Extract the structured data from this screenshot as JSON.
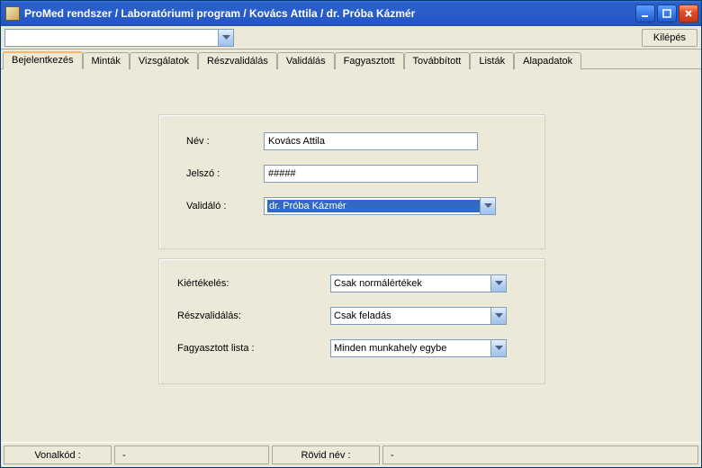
{
  "window": {
    "title": "ProMed rendszer / Laboratóriumi program / Kovács Attila / dr. Próba Kázmér"
  },
  "toolbar": {
    "combo_value": "",
    "exit_label": "Kilépés"
  },
  "tabs": [
    {
      "label": "Bejelentkezés",
      "active": true
    },
    {
      "label": "Minták"
    },
    {
      "label": "Vizsgálatok"
    },
    {
      "label": "Részvalidálás"
    },
    {
      "label": "Validálás"
    },
    {
      "label": "Fagyasztott"
    },
    {
      "label": "Továbbított"
    },
    {
      "label": "Listák"
    },
    {
      "label": "Alapadatok"
    }
  ],
  "login_panel": {
    "name_label": "Név :",
    "name_value": "Kovács Attila",
    "password_label": "Jelszó :",
    "password_value": "#####",
    "validator_label": "Validáló :",
    "validator_value": "dr. Próba Kázmér"
  },
  "options_panel": {
    "evaluation_label": "Kiértékelés:",
    "evaluation_value": "Csak normálértékek",
    "partvalidation_label": "Részvalidálás:",
    "partvalidation_value": "Csak feladás",
    "frozenlist_label": "Fagyasztott lista :",
    "frozenlist_value": "Minden munkahely egybe"
  },
  "statusbar": {
    "barcode_label": "Vonalkód :",
    "barcode_value": "-",
    "shortname_label": "Rövid név :",
    "shortname_value": "-"
  }
}
